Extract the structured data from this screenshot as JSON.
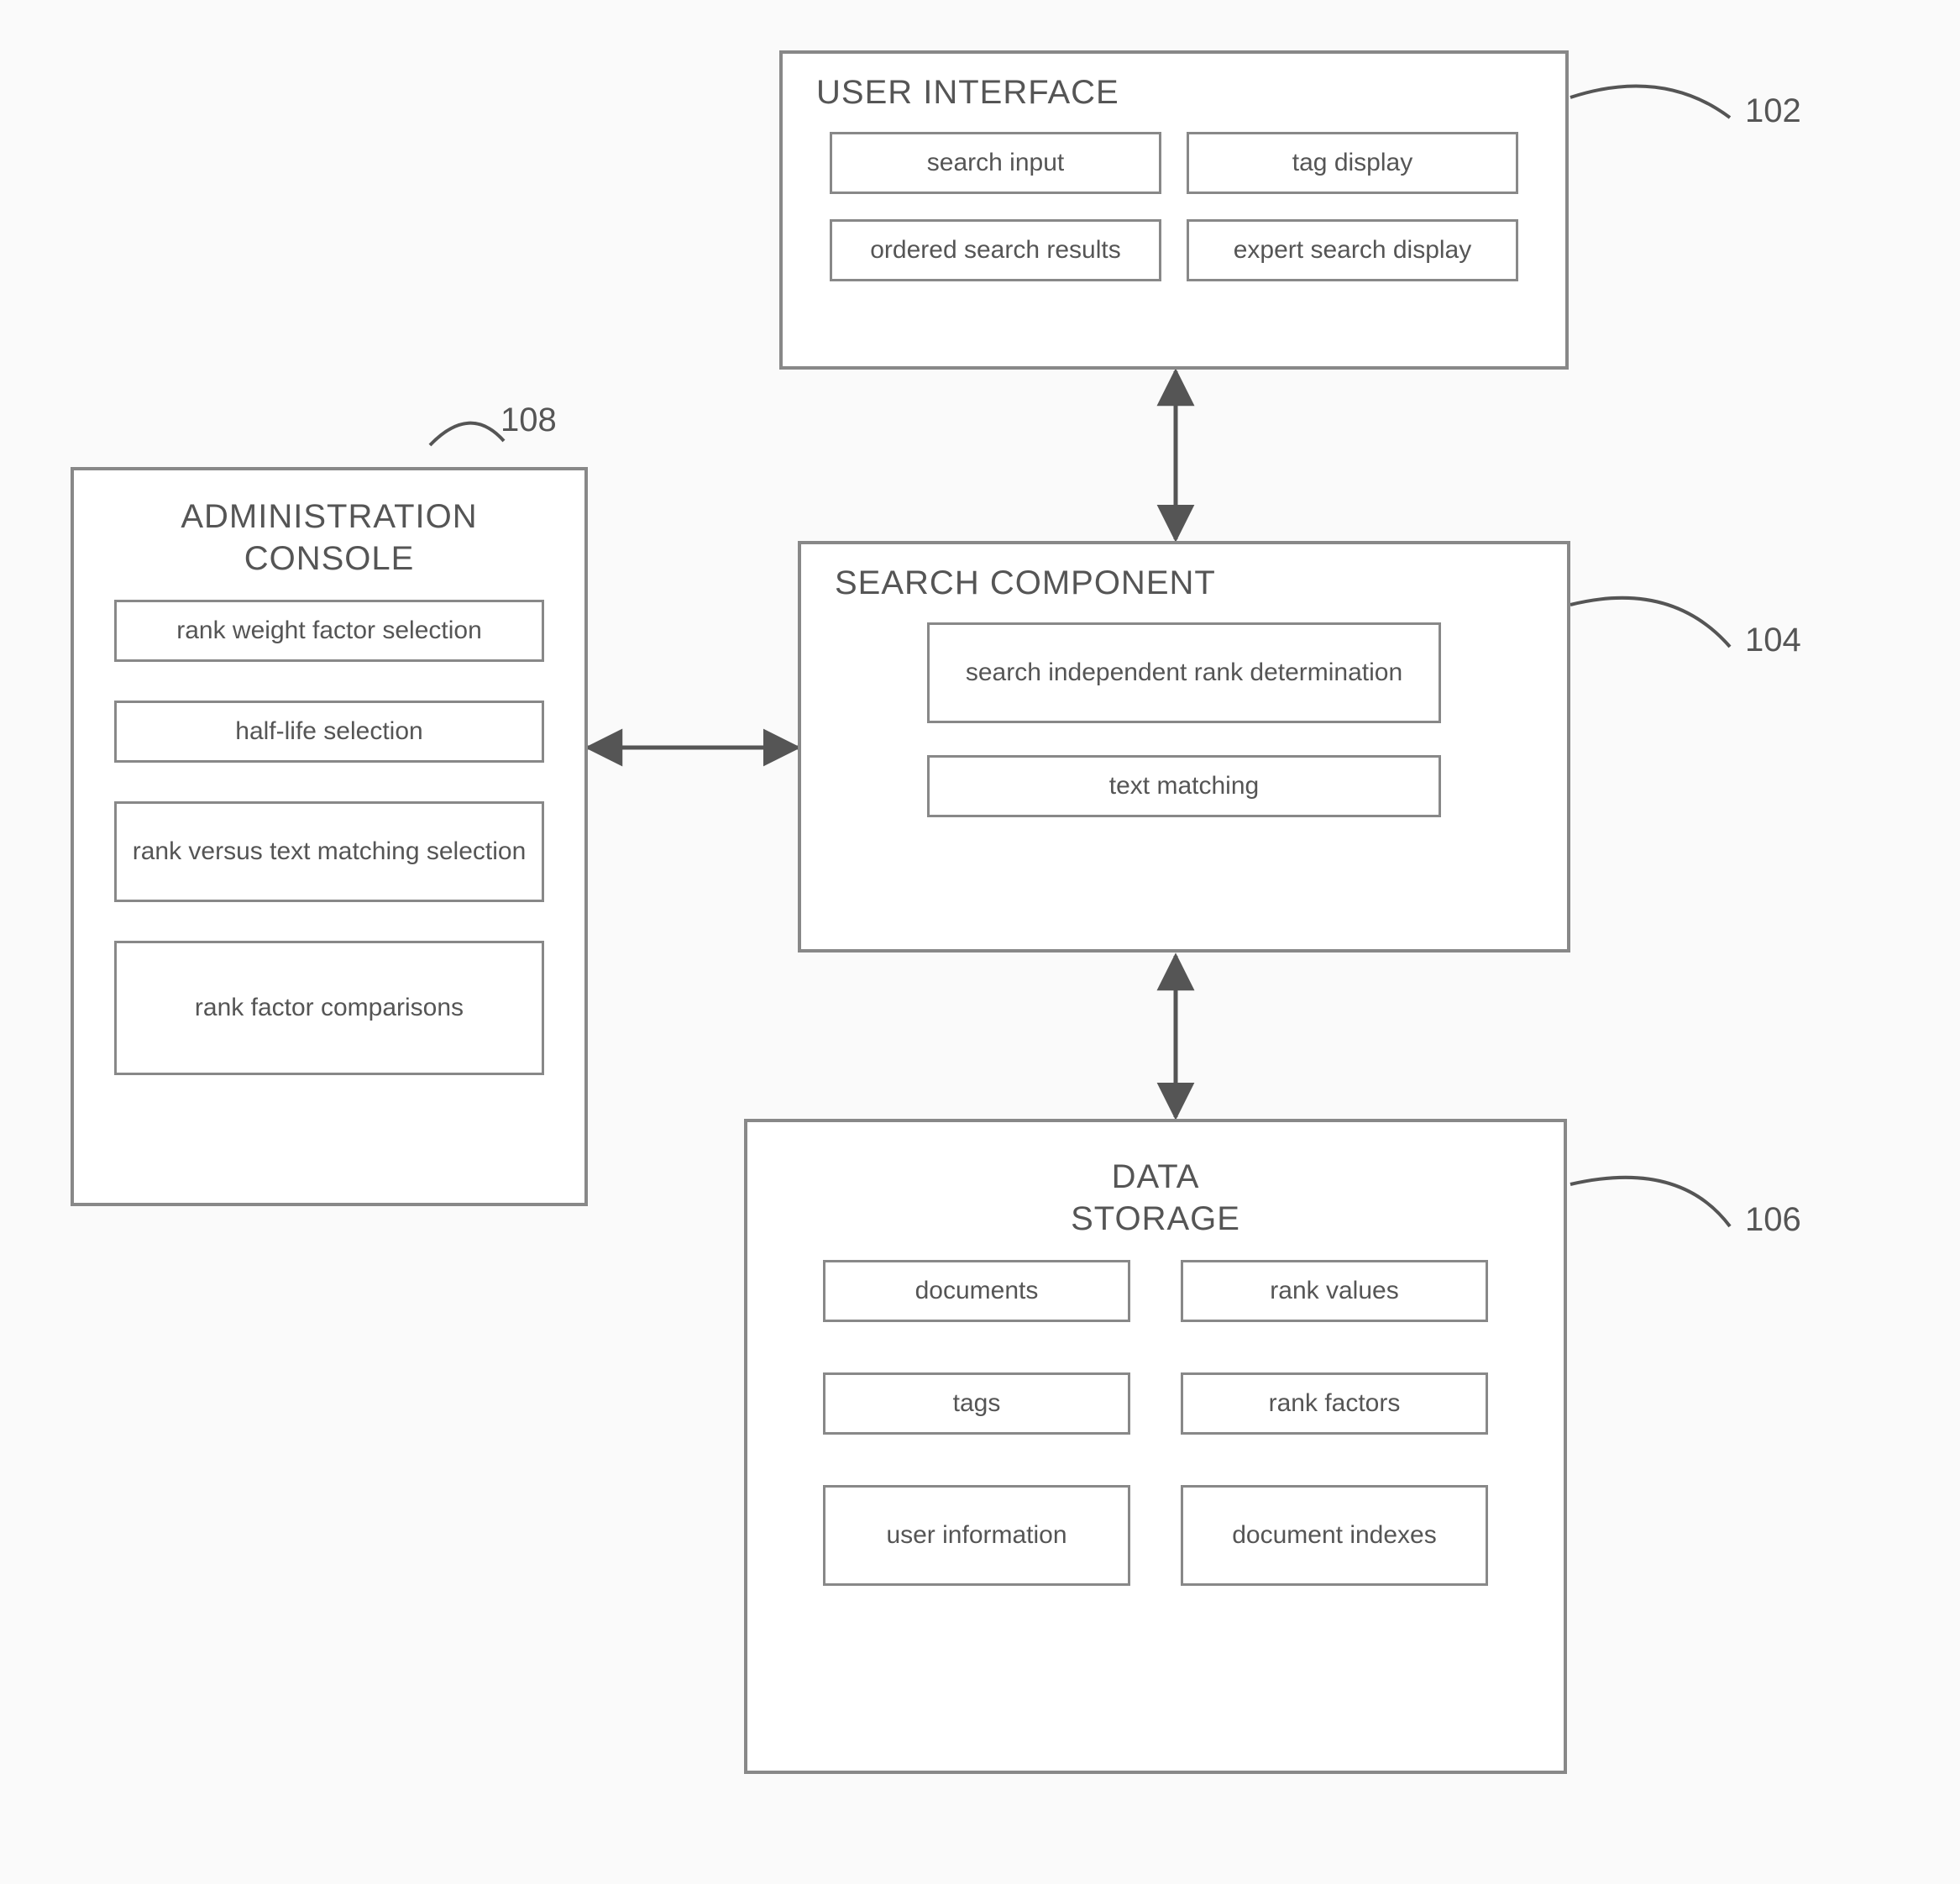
{
  "refs": {
    "ui": "102",
    "search": "104",
    "data": "106",
    "admin": "108"
  },
  "blocks": {
    "ui": {
      "title": "USER INTERFACE",
      "items": {
        "search_input": "search input",
        "tag_display": "tag display",
        "ordered_results": "ordered search results",
        "expert_display": "expert search display"
      }
    },
    "search": {
      "title": "SEARCH COMPONENT",
      "items": {
        "rank_det": "search independent rank determination",
        "text_match": "text matching"
      }
    },
    "data": {
      "title": "DATA STORAGE",
      "items": {
        "documents": "documents",
        "rank_values": "rank values",
        "tags": "tags",
        "rank_factors": "rank factors",
        "user_info": "user information",
        "doc_indexes": "document indexes"
      }
    },
    "admin": {
      "title": "ADMINISTRATION CONSOLE",
      "items": {
        "rw_sel": "rank weight factor selection",
        "hl_sel": "half-life selection",
        "rvt_sel": "rank versus text matching selection",
        "rf_comp": "rank factor comparisons"
      }
    }
  }
}
